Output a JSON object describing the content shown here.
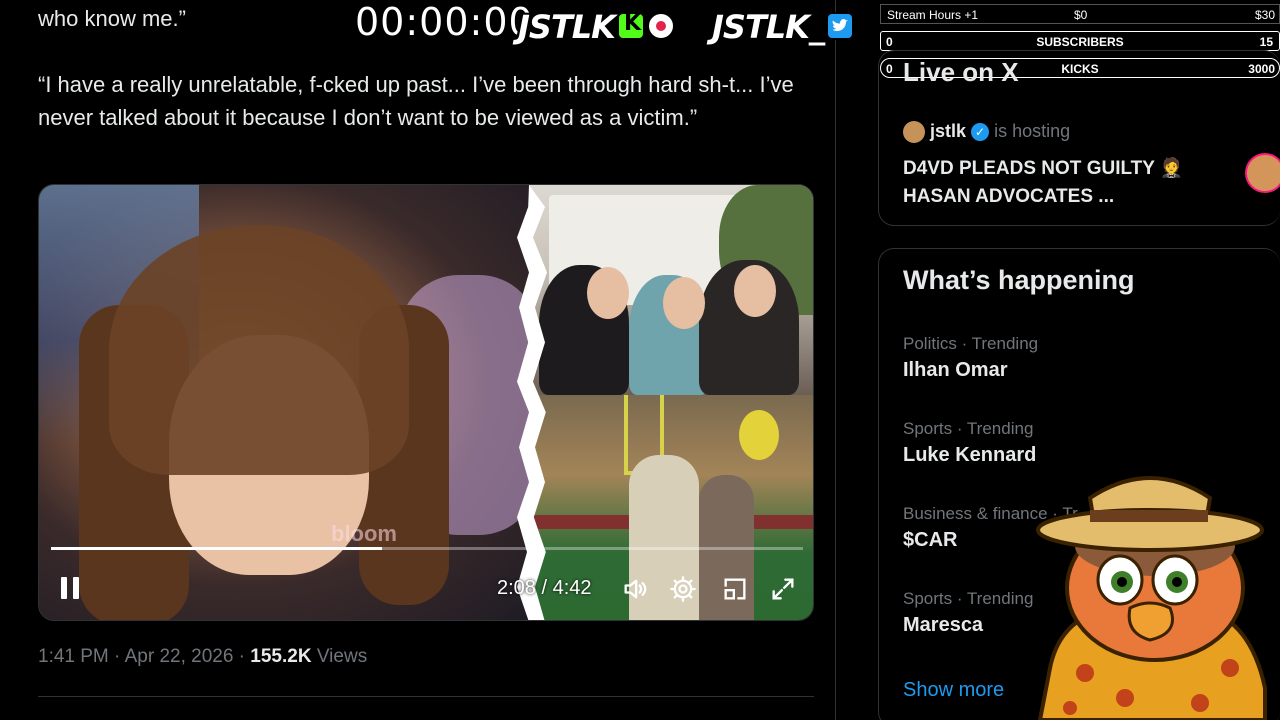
{
  "tweet": {
    "line_top": "who know me.”",
    "quote": "“I have a really unrelatable, f-cked up past... I’ve been through hard sh-t... I’ve never talked about it because I don’t want to be viewed as a victim.”",
    "meta_time": "1:41 PM · Apr 22, 2026 · ",
    "meta_views_count": "155.2K",
    "meta_views_label": " Views"
  },
  "video": {
    "watermark": "bloom",
    "current_time": "2:08",
    "separator": " / ",
    "duration": "4:42",
    "progress": 0.44,
    "icons": [
      "pause-icon",
      "volume-icon",
      "settings-icon",
      "dock-icon",
      "fullscreen-icon"
    ]
  },
  "overlay": {
    "timer": "00:00:00",
    "logo_kick": "JSTLK",
    "logo_twitter": "JSTLK_",
    "stream_hours_label": "Stream Hours +1",
    "stream_hours_min": "$0",
    "stream_hours_max": "$30",
    "subscribers_label": "SUBSCRIBERS",
    "subscribers_min": "0",
    "subscribers_max": "15",
    "kicks_label": "KICKS",
    "kicks_min": "0",
    "kicks_max": "3000"
  },
  "live": {
    "title": "Live on X",
    "host_name": "jstlk",
    "host_status": " is hosting",
    "headline": "D4VD PLEADS NOT GUILTY 🤵 HASAN ADVOCATES ..."
  },
  "trends": {
    "title": "What’s happening",
    "items": [
      {
        "category": "Politics · Trending",
        "name": "Ilhan Omar"
      },
      {
        "category": "Sports · Trending",
        "name": "Luke Kennard"
      },
      {
        "category": "Business & finance · Tr",
        "name": "$CAR"
      },
      {
        "category": "Sports · Trending",
        "name": "Maresca"
      }
    ],
    "show_more": "Show more"
  },
  "colors": {
    "accent": "#1d9bf0",
    "kick_green": "#53fc18",
    "muted": "#71767b",
    "text": "#e7e9ea",
    "border": "#2f3336"
  }
}
